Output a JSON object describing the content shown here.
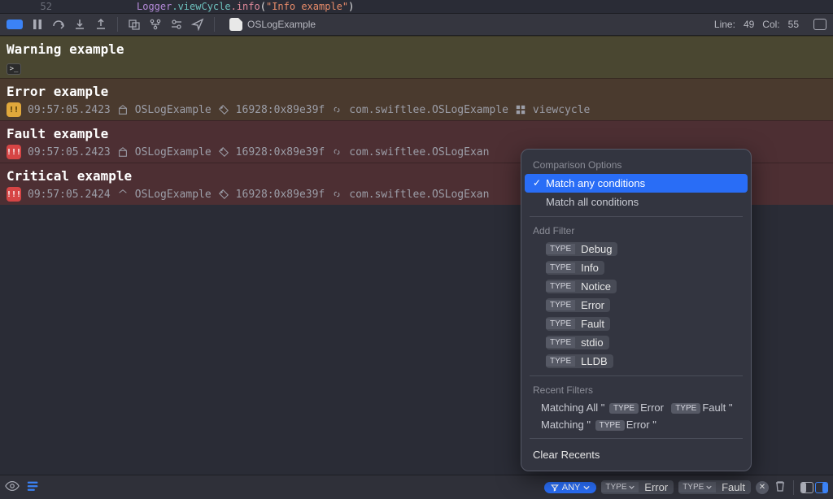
{
  "editor": {
    "line_number": "52",
    "code_segments": {
      "a": "Logger",
      "b": ".viewCycle",
      "c": ".info",
      "d": "(",
      "e": "\"Info example\"",
      "f": ")"
    }
  },
  "toolbar": {
    "file_name": "OSLogExample",
    "cursor_line_label": "Line:",
    "cursor_line": "49",
    "cursor_col_label": "Col:",
    "cursor_col": "55"
  },
  "logs": [
    {
      "key": "warn",
      "message": "Warning example"
    },
    {
      "key": "error",
      "message": "Error example",
      "badge": "!!",
      "ts": "09:57:05.2423",
      "process": "OSLogExample",
      "thread": "16928:0x89e39f",
      "subsystem": "com.swiftlee.OSLogExample",
      "category": "viewcycle"
    },
    {
      "key": "fault",
      "message": "Fault example",
      "badge": "!!!",
      "ts": "09:57:05.2423",
      "process": "OSLogExample",
      "thread": "16928:0x89e39f",
      "subsystem_trunc": "com.swiftlee.OSLogExan"
    },
    {
      "key": "crit",
      "message": "Critical example",
      "badge": "!!!",
      "ts": "09:57:05.2424",
      "process": "OSLogExample",
      "thread": "16928:0x89e39f",
      "subsystem_trunc": "com.swiftlee.OSLogExan"
    }
  ],
  "popup": {
    "comparison_header": "Comparison Options",
    "match_any": "Match any conditions",
    "match_all": "Match all conditions",
    "add_filter_header": "Add Filter",
    "type_label": "TYPE",
    "filters": [
      "Debug",
      "Info",
      "Notice",
      "Error",
      "Fault",
      "stdio",
      "LLDB"
    ],
    "recent_header": "Recent Filters",
    "recent_all_prefix": "Matching All \" ",
    "recent_all_a": "Error",
    "recent_all_b": "Fault",
    "recent_one_prefix": "Matching \" ",
    "recent_one_a": "Error",
    "quote_close": " \"",
    "clear": "Clear Recents"
  },
  "footer": {
    "any_label": "ANY",
    "type_label": "TYPE",
    "filter_a": "Error",
    "filter_b": "Fault"
  },
  "colors": {
    "blue": "#296df6",
    "code_purple": "#b48ad9",
    "code_teal": "#6dc0bd",
    "code_pink": "#e18b9b",
    "code_coral": "#e88c6a"
  }
}
